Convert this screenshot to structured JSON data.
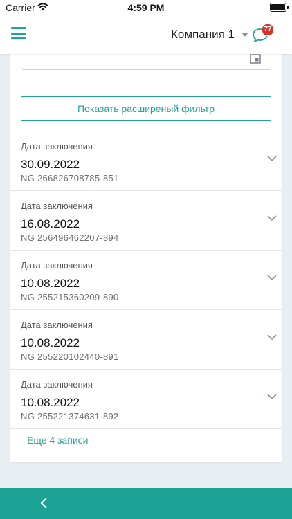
{
  "status_bar": {
    "carrier": "Carrier",
    "time": "4:59 PM"
  },
  "header": {
    "company_name": "Компания 1",
    "notification_count": "77",
    "accent_color": "#20a39a",
    "badge_color": "#d9302c"
  },
  "filter": {
    "show_extended_label": "Показать расширеный фильтр"
  },
  "contracts": [
    {
      "label": "Дата заключения",
      "date": "30.09.2022",
      "number": "NG 266826708785-851"
    },
    {
      "label": "Дата заключения",
      "date": "16.08.2022",
      "number": "NG 256496462207-894"
    },
    {
      "label": "Дата заключения",
      "date": "10.08.2022",
      "number": "NG 255215360209-890"
    },
    {
      "label": "Дата заключения",
      "date": "10.08.2022",
      "number": "NG 255220102440-891"
    },
    {
      "label": "Дата заключения",
      "date": "10.08.2022",
      "number": "NG 255221374631-892"
    }
  ],
  "more_link": "Еще 4 записи",
  "icons": {
    "menu": "hamburger-icon",
    "chat": "chat-bubble-icon",
    "calendar": "calendar-icon",
    "chevron": "chevron-down-icon",
    "back": "chevron-left-icon"
  },
  "bottom_bar_color": "#1da296"
}
